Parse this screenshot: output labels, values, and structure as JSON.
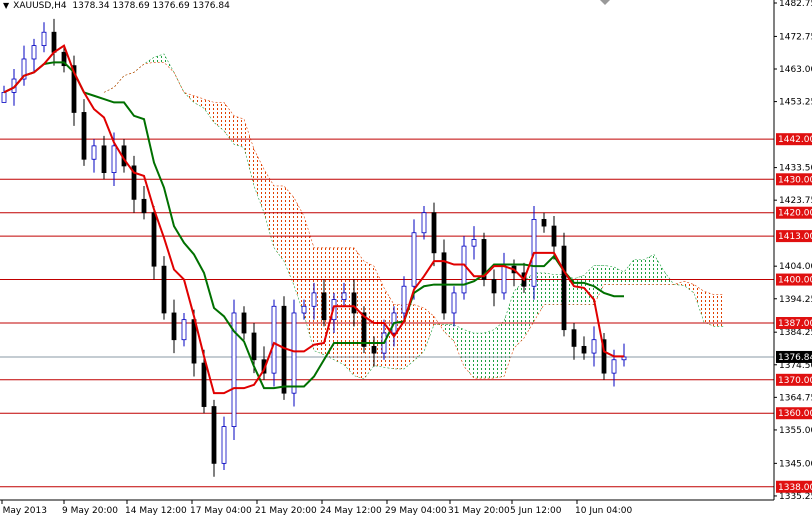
{
  "header": {
    "symbol": "XAUUSD,H4",
    "ohlc": "1378.34 1378.69 1376.69 1376.84"
  },
  "colors": {
    "bull": "#0000c0",
    "bear": "#000000",
    "tenkan": "#e00000",
    "kijun": "#007000",
    "levels": "#c00000",
    "cloudUp": "#20a040",
    "cloudDown": "#e04000"
  },
  "chart_data": {
    "type": "candlestick",
    "ylim": [
      1335.25,
      1482.75
    ],
    "y_ticks": [
      "1482.75",
      "1472.75",
      "1463.00",
      "1453.25",
      "1433.50",
      "1423.75",
      "1404.00",
      "1394.25",
      "1384.25",
      "1374.50",
      "1364.75",
      "1355.00",
      "1345.00",
      "1335.25"
    ],
    "x_labels": [
      "7 May 2013",
      "9 May 20:00",
      "14 May 12:00",
      "17 May 04:00",
      "21 May 20:00",
      "24 May 12:00",
      "29 May 04:00",
      "31 May 20:00",
      "5 Jun 12:00",
      "10 Jun 04:00"
    ],
    "closes": [
      1456,
      1460,
      1466,
      1470,
      1474,
      1468,
      1464,
      1450,
      1436,
      1440,
      1432,
      1440,
      1434,
      1424,
      1420,
      1404,
      1390,
      1382,
      1388,
      1375,
      1362,
      1345,
      1356,
      1390,
      1384,
      1376,
      1372,
      1392,
      1366,
      1390,
      1392,
      1396,
      1388,
      1394,
      1396,
      1390,
      1380,
      1378,
      1384,
      1390,
      1398,
      1414,
      1420,
      1408,
      1390,
      1396,
      1410,
      1412,
      1400,
      1396,
      1404,
      1402,
      1398,
      1418,
      1416,
      1410,
      1385,
      1380,
      1378,
      1382,
      1372,
      1376,
      1376.84
    ],
    "levels": [
      "1442.00",
      "1430.00",
      "1420.00",
      "1413.00",
      "1400.00",
      "1387.00",
      "1370.00",
      "1360.00",
      "1338.00"
    ],
    "current_price": "1376.84",
    "series": [
      "Price (H4 candles)",
      "Tenkan-sen (red)",
      "Kijun-sen (green)",
      "Ichimoku cloud"
    ]
  }
}
